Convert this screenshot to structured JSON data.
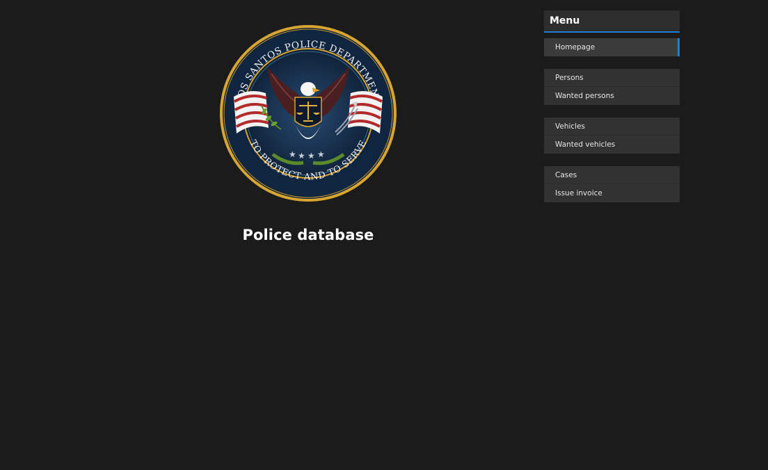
{
  "page": {
    "title": "Police database"
  },
  "seal": {
    "top_text": "LOS SANTOS POLICE DEPARTMENT",
    "bottom_text": "TO PROTECT AND TO SERVE"
  },
  "menu": {
    "header": "Menu",
    "groups": [
      {
        "items": [
          {
            "label": "Homepage",
            "active": true
          }
        ]
      },
      {
        "items": [
          {
            "label": "Persons"
          },
          {
            "label": "Wanted persons"
          }
        ]
      },
      {
        "items": [
          {
            "label": "Vehicles"
          },
          {
            "label": "Wanted vehicles"
          }
        ]
      },
      {
        "items": [
          {
            "label": "Cases"
          },
          {
            "label": "Issue invoice"
          }
        ]
      }
    ]
  },
  "colors": {
    "background": "#1b1b1b",
    "accent": "#1f7fd4",
    "seal_gold": "#d9a531",
    "seal_blue": "#16304d"
  }
}
